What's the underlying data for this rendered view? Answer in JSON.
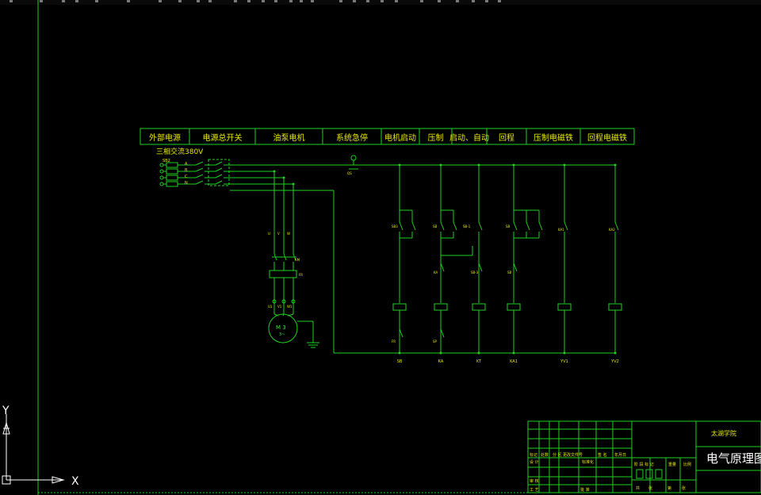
{
  "header_columns": [
    "外部电源",
    "电源总开关",
    "油泵电机",
    "系统急停",
    "电机启动",
    "压制",
    "启动、自动",
    "回程",
    "压制电磁铁",
    "回程电磁铁"
  ],
  "supply_label": "三相交流380V",
  "supply_tag": "SB2",
  "phase_labels": [
    "A",
    "B",
    "C",
    "N"
  ],
  "estop_tag": "QS",
  "ladder_bottom_tags": [
    "SB",
    "KA",
    "KT",
    "KA1",
    "YV1",
    "YV2"
  ],
  "motor": {
    "label": "M 3",
    "sub": "3~",
    "contact_tag": "KM",
    "fuse_tag": "FR",
    "top_tags": [
      "U",
      "V",
      "W"
    ],
    "bottom_tags": [
      "U1",
      "V1",
      "W1"
    ]
  },
  "coil_tags": [
    "SB3",
    "SB",
    "SB-1",
    "SB",
    "KA1",
    "KA2"
  ],
  "mid_tags": [
    "KA",
    "SB-3",
    "SB"
  ],
  "lower_tags": [
    "FR",
    "SP"
  ],
  "title_block": {
    "school": "太湖学院",
    "drawing_title": "电气原理图",
    "rows": [
      "标记",
      "处数",
      "分 区",
      "更改文件号",
      "签 名",
      "年月日"
    ],
    "row2": [
      "设 计",
      "标准化"
    ],
    "row3": [
      "审 核"
    ],
    "row4": [
      "工 艺",
      "批 准"
    ],
    "stage": "阶 段 标 记",
    "weight": "重量",
    "scale": "比例",
    "sheet": [
      "共",
      "张",
      "第",
      "张"
    ]
  },
  "ucs": {
    "y": "Y",
    "x": "X"
  },
  "colors": {
    "background": "#000000",
    "line": "#1fd11f",
    "text": "#e7e700",
    "ucs": "#ffffff"
  }
}
